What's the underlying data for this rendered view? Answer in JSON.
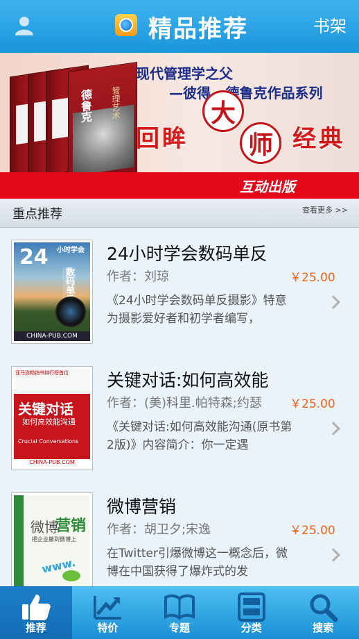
{
  "header": {
    "title": "精品推荐",
    "shelf_label": "书架"
  },
  "banner": {
    "headline_1": "现代管理学之父",
    "headline_2": "—彼得 · 德鲁克作品系列",
    "slogan": [
      "回",
      "眸",
      "大",
      "师",
      "经",
      "典"
    ],
    "publisher": "互动出版",
    "cover_title": "德鲁克",
    "cover_subtitle": "管理艺术"
  },
  "section": {
    "title": "重点推荐",
    "more_label": "查看更多 >>"
  },
  "books": [
    {
      "title": "24小时学会数码单反",
      "author": "作者：刘琼",
      "price": "￥25.00",
      "description": "《24小时学会数码单反摄影》特意为摄影爱好者和初学者编写，",
      "cover": {
        "big": "24",
        "small": "小时学会",
        "vertical": "数码单反摄影",
        "footer": "CHINA-PUB.COM"
      }
    },
    {
      "title": "关键对话:如何高效能",
      "author": "作者：(美)科里.帕特森;约瑟",
      "price": "￥25.00",
      "description": "《关键对话:如何高效能沟通(原书第2版)》内容简介：你一定遇",
      "cover": {
        "top": "亚马逊畅销书排行榜首位",
        "big": "关键对话",
        "small": "如何高效能沟通",
        "english": "Crucial Conversations",
        "footer": "CHINA-PUB.COM"
      }
    },
    {
      "title": "微博营销",
      "author": "作者：胡卫夕;宋逸",
      "price": "￥25.00",
      "description": "在Twitter引爆微博这一概念后，微博在中国获得了爆炸式的发",
      "cover": {
        "a": "微博",
        "b": "营销",
        "sub": "把企业搬到微博上",
        "www": "www."
      }
    }
  ],
  "tabs": [
    {
      "label": "推荐",
      "icon": "thumbs-up-icon",
      "active": true
    },
    {
      "label": "特价",
      "icon": "trend-arrow-icon",
      "active": false
    },
    {
      "label": "专题",
      "icon": "open-book-icon",
      "active": false
    },
    {
      "label": "分类",
      "icon": "categories-icon",
      "active": false
    },
    {
      "label": "搜索",
      "icon": "search-icon",
      "active": false
    }
  ]
}
